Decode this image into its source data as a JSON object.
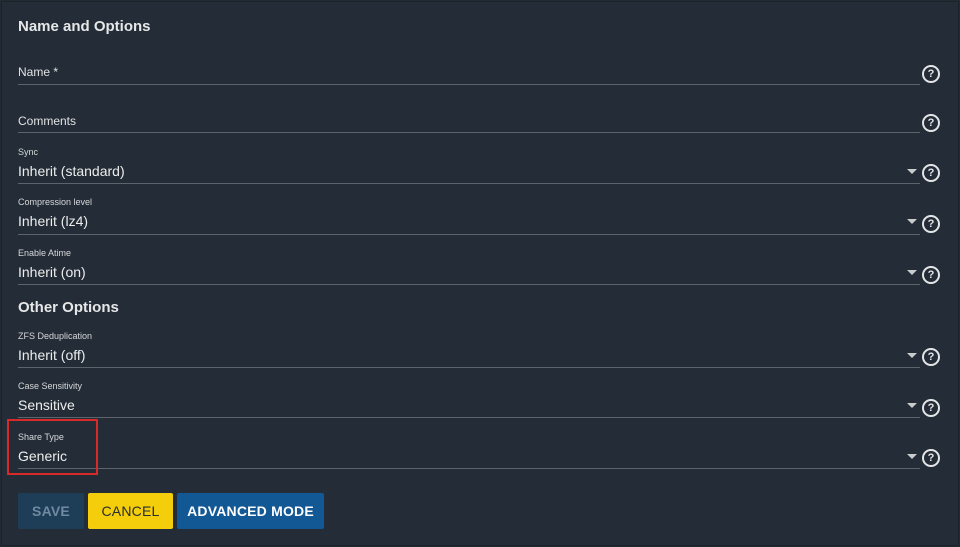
{
  "sections": {
    "name_and_options": "Name and Options",
    "other_options": "Other Options"
  },
  "fields": {
    "name": {
      "label": "Name *",
      "value": ""
    },
    "comments": {
      "label": "Comments",
      "value": ""
    },
    "sync": {
      "label": "Sync",
      "value": "Inherit (standard)"
    },
    "compression": {
      "label": "Compression level",
      "value": "Inherit (lz4)"
    },
    "atime": {
      "label": "Enable Atime",
      "value": "Inherit (on)"
    },
    "dedup": {
      "label": "ZFS Deduplication",
      "value": "Inherit (off)"
    },
    "case_sensitivity": {
      "label": "Case Sensitivity",
      "value": "Sensitive"
    },
    "share_type": {
      "label": "Share Type",
      "value": "Generic"
    }
  },
  "help_glyph": "?",
  "buttons": {
    "save": "SAVE",
    "cancel": "CANCEL",
    "advanced": "ADVANCED MODE"
  },
  "colors": {
    "background": "#242d37",
    "highlight": "#d92a2a",
    "cancel": "#f4cd0b",
    "advanced": "#115894",
    "save_disabled": "#1e3e58"
  },
  "icons": {
    "help": "help-circle-icon",
    "dropdown": "caret-down-icon"
  }
}
